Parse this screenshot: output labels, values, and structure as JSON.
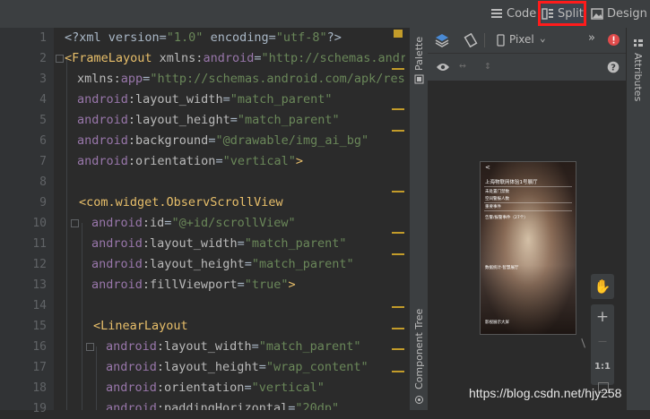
{
  "toolbar": {
    "modes": [
      {
        "label": "Code",
        "icon": "code-view-icon"
      },
      {
        "label": "Split",
        "icon": "split-view-icon",
        "selected": true
      },
      {
        "label": "Design",
        "icon": "design-view-icon"
      }
    ],
    "highlight_color": "#ff1b1b"
  },
  "editor": {
    "line_numbers": [
      "1",
      "2",
      "3",
      "4",
      "5",
      "6",
      "7",
      "8",
      "9",
      "10",
      "11",
      "12",
      "13",
      "14",
      "15",
      "16",
      "17",
      "18",
      "19"
    ],
    "lines": [
      {
        "parts": [
          {
            "t": "pl",
            "v": "<?xml version="
          },
          {
            "t": "str",
            "v": "\"1.0\""
          },
          {
            "t": "pl",
            "v": " encoding="
          },
          {
            "t": "str",
            "v": "\"utf-8\""
          },
          {
            "t": "pl",
            "v": "?>"
          }
        ]
      },
      {
        "parts": [
          {
            "t": "tag",
            "v": "<FrameLayout "
          },
          {
            "t": "attrname",
            "v": "xmlns:"
          },
          {
            "t": "ns",
            "v": "android"
          },
          {
            "t": "pl",
            "v": "="
          },
          {
            "t": "str",
            "v": "\"http://schemas.android.co"
          }
        ]
      },
      {
        "parts": [
          {
            "t": "attrname",
            "v": "xmlns:"
          },
          {
            "t": "ns",
            "v": "app"
          },
          {
            "t": "pl",
            "v": "="
          },
          {
            "t": "str",
            "v": "\"http://schemas.android.com/apk/res-auto"
          }
        ]
      },
      {
        "parts": [
          {
            "t": "ns",
            "v": "android"
          },
          {
            "t": "attrname",
            "v": ":layout_width"
          },
          {
            "t": "pl",
            "v": "="
          },
          {
            "t": "str",
            "v": "\"match_parent\""
          }
        ]
      },
      {
        "parts": [
          {
            "t": "ns",
            "v": "android"
          },
          {
            "t": "attrname",
            "v": ":layout_height"
          },
          {
            "t": "pl",
            "v": "="
          },
          {
            "t": "str",
            "v": "\"match_parent\""
          }
        ]
      },
      {
        "parts": [
          {
            "t": "ns",
            "v": "android"
          },
          {
            "t": "attrname",
            "v": ":background"
          },
          {
            "t": "pl",
            "v": "="
          },
          {
            "t": "str",
            "v": "\"@drawable/img_ai_bg\""
          }
        ]
      },
      {
        "parts": [
          {
            "t": "ns",
            "v": "android"
          },
          {
            "t": "attrname",
            "v": ":orientation"
          },
          {
            "t": "pl",
            "v": "="
          },
          {
            "t": "str",
            "v": "\"vertical\""
          },
          {
            "t": "tag",
            "v": ">"
          }
        ]
      },
      {
        "parts": []
      },
      {
        "parts": [
          {
            "t": "tag",
            "v": "<com.widget.ObservScrollView"
          }
        ]
      },
      {
        "parts": [
          {
            "t": "ns",
            "v": "android"
          },
          {
            "t": "attrname",
            "v": ":id"
          },
          {
            "t": "pl",
            "v": "="
          },
          {
            "t": "str",
            "v": "\"@+id/scrollView\""
          }
        ]
      },
      {
        "parts": [
          {
            "t": "ns",
            "v": "android"
          },
          {
            "t": "attrname",
            "v": ":layout_width"
          },
          {
            "t": "pl",
            "v": "="
          },
          {
            "t": "str",
            "v": "\"match_parent\""
          }
        ]
      },
      {
        "parts": [
          {
            "t": "ns",
            "v": "android"
          },
          {
            "t": "attrname",
            "v": ":layout_height"
          },
          {
            "t": "pl",
            "v": "="
          },
          {
            "t": "str",
            "v": "\"match_parent\""
          }
        ]
      },
      {
        "parts": [
          {
            "t": "ns",
            "v": "android"
          },
          {
            "t": "attrname",
            "v": ":fillViewport"
          },
          {
            "t": "pl",
            "v": "="
          },
          {
            "t": "str",
            "v": "\"true\""
          },
          {
            "t": "tag",
            "v": ">"
          }
        ]
      },
      {
        "parts": []
      },
      {
        "parts": [
          {
            "t": "tag",
            "v": "<LinearLayout"
          }
        ]
      },
      {
        "parts": [
          {
            "t": "ns",
            "v": "android"
          },
          {
            "t": "attrname",
            "v": ":layout_width"
          },
          {
            "t": "pl",
            "v": "="
          },
          {
            "t": "str",
            "v": "\"match_parent\""
          }
        ]
      },
      {
        "parts": [
          {
            "t": "ns",
            "v": "android"
          },
          {
            "t": "attrname",
            "v": ":layout_height"
          },
          {
            "t": "pl",
            "v": "="
          },
          {
            "t": "str",
            "v": "\"wrap_content\""
          }
        ]
      },
      {
        "parts": [
          {
            "t": "ns",
            "v": "android"
          },
          {
            "t": "attrname",
            "v": ":orientation"
          },
          {
            "t": "pl",
            "v": "="
          },
          {
            "t": "str",
            "v": "\"vertical\""
          }
        ]
      },
      {
        "parts": [
          {
            "t": "ns",
            "v": "android"
          },
          {
            "t": "attrname",
            "v": ":paddingHorizontal"
          },
          {
            "t": "pl",
            "v": "="
          },
          {
            "t": "str",
            "v": "\"20dp\""
          }
        ]
      }
    ]
  },
  "side_panels": {
    "palette": "Palette",
    "component_tree": "Component Tree",
    "attributes": "Attributes"
  },
  "design_toolbar": {
    "device": "Pixel",
    "more": "»",
    "zoom_one_to_one": "1:1",
    "zoom_in": "+",
    "zoom_out": "—"
  },
  "phone_preview": {
    "back": "<",
    "title": "上海物联网体验1号展厅",
    "rows": [
      "未处置门禁数",
      "空间警报人数",
      "重要事件",
      "告警/报警事件（27个）"
    ],
    "footer_label": "数据统计·智慧展厅",
    "bottom_label": "影视展示大屏"
  },
  "watermark": "https://blog.csdn.net/hjy258",
  "colors": {
    "tag": "#e8bf6a",
    "namespace": "#9876aa",
    "string": "#6a8759",
    "plain": "#a9b7c6",
    "error": "#e04b4b"
  }
}
